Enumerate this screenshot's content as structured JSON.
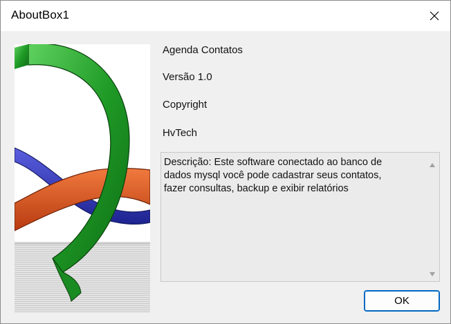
{
  "window": {
    "title": "AboutBox1"
  },
  "about": {
    "product_name": "Agenda Contatos",
    "version": "Versão 1.0",
    "copyright": "Copyright",
    "company": "HvTech",
    "description": "Descrição: Este software conectado ao banco de\ndados mysql você pode cadastrar seus contatos,\nfazer consultas, backup e exibir relatórios"
  },
  "buttons": {
    "ok_label": "OK"
  },
  "icons": {
    "close": "close-icon",
    "scroll_up": "scroll-up-arrow-icon",
    "scroll_down": "scroll-down-arrow-icon"
  },
  "colors": {
    "ring_green": "#23a02a",
    "ring_red": "#d8501e",
    "ring_blue": "#3a3fb8",
    "accent": "#0067c0"
  }
}
